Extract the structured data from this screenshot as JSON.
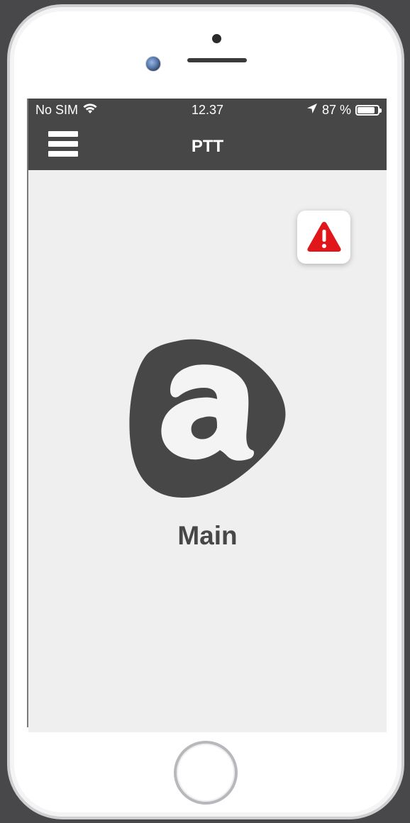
{
  "status_bar": {
    "carrier": "No SIM",
    "time": "12.37",
    "battery_text": "87 %",
    "battery_level": 0.87,
    "icons": [
      "wifi-icon",
      "location-arrow-icon",
      "battery-icon"
    ]
  },
  "nav": {
    "title": "PTT",
    "menu_icon": "hamburger-menu-icon"
  },
  "alert": {
    "icon": "warning-triangle-icon",
    "color": "#e0161b"
  },
  "main": {
    "logo_icon": "logo-a-icon",
    "label": "Main"
  },
  "colors": {
    "bar_background": "#474747",
    "screen_background": "#efefef",
    "alert_red": "#e0161b",
    "logo_dark": "#474747"
  }
}
